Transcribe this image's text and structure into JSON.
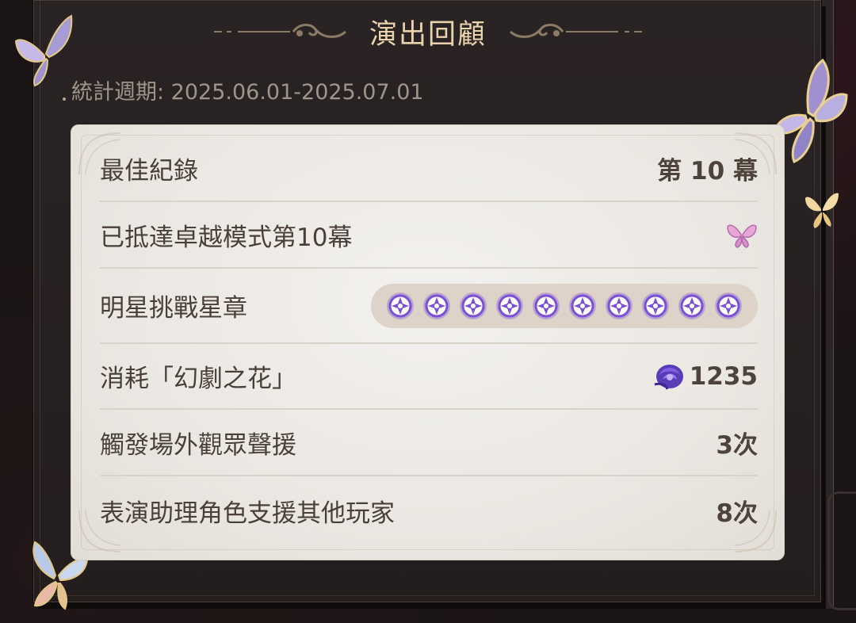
{
  "header": {
    "title": "演出回顧",
    "period": "統計週期: 2025.06.01-2025.07.01"
  },
  "rows": [
    {
      "label": "最佳紀錄",
      "value": "第 10 幕"
    },
    {
      "label": "已抵達卓越模式第10幕",
      "icon": "pink-butterfly-icon"
    },
    {
      "label": "明星挑戰星章",
      "badge_count": 10,
      "badge_icon": "purple-star-badge-icon"
    },
    {
      "label": "消耗「幻劇之花」",
      "icon": "purple-rose-icon",
      "value": "1235"
    },
    {
      "label": "觸發場外觀眾聲援",
      "value": "3次"
    },
    {
      "label": "表演助理角色支援其他玩家",
      "value": "8次"
    }
  ],
  "colors": {
    "title": "#e9d3ac",
    "panel": "#ebe7e2",
    "badge": "#7b4fd6",
    "text": "#4a3f38"
  }
}
